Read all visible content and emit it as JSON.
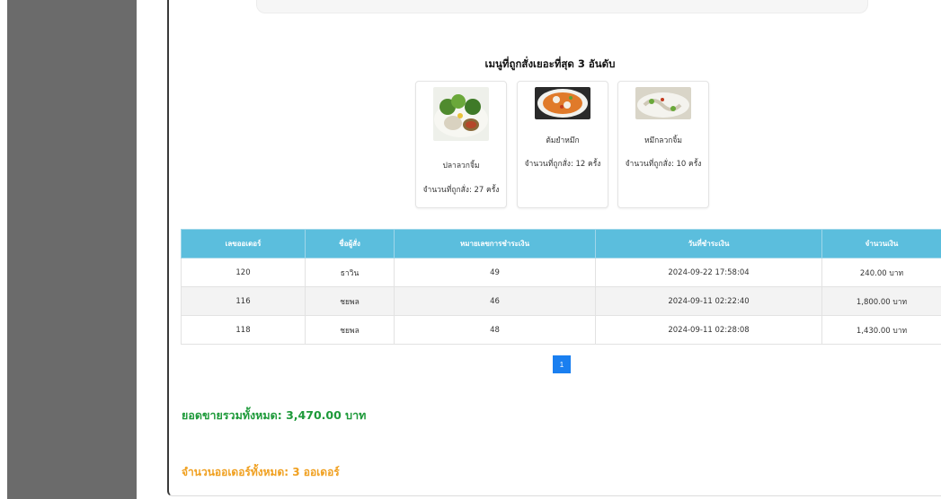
{
  "top_menu": {
    "title": "เมนูที่ถูกสั่งเยอะที่สุด 3 อันดับ",
    "items": [
      {
        "name": "ปลาลวกจิ้ม",
        "count": "จำนวนที่ถูกสั่ง: 27 ครั้ง",
        "image": "plated-dish-with-vegetables-and-dip"
      },
      {
        "name": "ต้มยำหมึก",
        "count": "จำนวนที่ถูกสั่ง: 12 ครั้ง",
        "image": "tom-yum-squid-soup-bowl"
      },
      {
        "name": "หมึกลวกจิ้ม",
        "count": "จำนวนที่ถูกสั่ง: 10 ครั้ง",
        "image": "blanched-squid-platter"
      }
    ]
  },
  "orders_table": {
    "headers": [
      "เลขออเดอร์",
      "ชื่อผู้สั่ง",
      "หมายเลขการชำระเงิน",
      "วันที่ชำระเงิน",
      "จำนวนเงิน"
    ],
    "rows": [
      [
        "120",
        "ธาวิน",
        "49",
        "2024-09-22 17:58:04",
        "240.00 บาท"
      ],
      [
        "116",
        "ชยพล",
        "46",
        "2024-09-11 02:22:40",
        "1,800.00 บาท"
      ],
      [
        "118",
        "ชยพล",
        "48",
        "2024-09-11 02:28:08",
        "1,430.00 บาท"
      ]
    ]
  },
  "pagination": {
    "current": "1"
  },
  "summary": {
    "total_sales": "ยอดขายรวมทั้งหมด: 3,470.00 บาท",
    "total_orders": "จำนวนออเดอร์ทั้งหมด: 3 ออเดอร์"
  }
}
